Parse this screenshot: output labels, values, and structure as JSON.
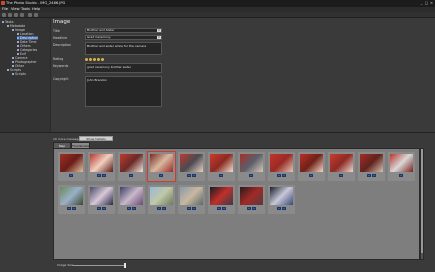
{
  "window": {
    "title": "The Photo Studio - IMG_2486.JPG",
    "controls": [
      "_",
      "□",
      "×"
    ]
  },
  "menu": [
    "File",
    "View",
    "Tools",
    "Help"
  ],
  "tree": {
    "items": [
      {
        "label": "Tasks",
        "level": 0
      },
      {
        "label": "Metadata",
        "level": 1
      },
      {
        "label": "Image",
        "level": 2
      },
      {
        "label": "Location",
        "level": 3
      },
      {
        "label": "Description",
        "level": 3,
        "selected": true
      },
      {
        "label": "Date Time",
        "level": 3
      },
      {
        "label": "Others",
        "level": 3
      },
      {
        "label": "Categories",
        "level": 3
      },
      {
        "label": "Exif",
        "level": 3
      },
      {
        "label": "Camera",
        "level": 2
      },
      {
        "label": "Photographer",
        "level": 2
      },
      {
        "label": "Other",
        "level": 2
      },
      {
        "label": "Scripts",
        "level": 1
      },
      {
        "label": "Scripts",
        "level": 2
      }
    ]
  },
  "detail": {
    "heading": "Image",
    "title_label": "Title",
    "title_value": "Brother and Sister",
    "headline_label": "Headline",
    "headline_value": "Grad Ceremony",
    "description_label": "Description",
    "description_value": "Brother and sister smile for the camera",
    "rating_label": "Rating",
    "rating_value": 5,
    "keywords_label": "Keywords",
    "keywords_value": "grad ceremony brother sister",
    "copyright_label": "Copyright",
    "copyright_value": "John Brandon"
  },
  "filter": {
    "label": "10 more messages",
    "button": "Show Details"
  },
  "tabs": [
    "Map Browse",
    "Thumbnails"
  ],
  "active_tab": 1,
  "zoom_label": "Image Size",
  "zoom_level": 1.0,
  "thumbnails": {
    "row1": [
      {
        "colors": [
          "#a0302a",
          "#6a1c18",
          "#e0c0a0"
        ],
        "selected": false
      },
      {
        "colors": [
          "#b8352e",
          "#f0d0c0",
          "#5a1a16"
        ],
        "selected": false
      },
      {
        "colors": [
          "#c23a30",
          "#6a2a28",
          "#f2e6dc"
        ],
        "selected": false
      },
      {
        "colors": [
          "#7a2a24",
          "#d8b8a0",
          "#9a2c26"
        ],
        "selected": true
      },
      {
        "colors": [
          "#c03a2e",
          "#4a4a52",
          "#e8d0c0"
        ],
        "selected": false
      },
      {
        "colors": [
          "#d03a2e",
          "#8a2a22",
          "#f0e0d0"
        ],
        "selected": false
      },
      {
        "colors": [
          "#a8302a",
          "#5a5e6a",
          "#d8c8b8"
        ],
        "selected": false
      },
      {
        "colors": [
          "#c0362c",
          "#9a2a24",
          "#e0c8b8"
        ],
        "selected": false
      },
      {
        "colors": [
          "#b83026",
          "#702018",
          "#f0d8c8"
        ],
        "selected": false
      },
      {
        "colors": [
          "#c83c30",
          "#8e2a24",
          "#eadad0"
        ],
        "selected": false
      },
      {
        "colors": [
          "#a42e28",
          "#60221c",
          "#d8c0b0"
        ],
        "selected": false
      },
      {
        "colors": [
          "#b8342a",
          "#d8d8d8",
          "#78221c"
        ],
        "selected": false
      }
    ],
    "row2": [
      {
        "colors": [
          "#6a8a5a",
          "#9ab0c8",
          "#3a4a30"
        ],
        "selected": false
      },
      {
        "colors": [
          "#4a4a6a",
          "#d8c8d8",
          "#2a2a44"
        ],
        "selected": false
      },
      {
        "colors": [
          "#3a4068",
          "#c8b8c8",
          "#6a4a7a"
        ],
        "selected": false
      },
      {
        "colors": [
          "#9ab8d8",
          "#c0c8a8",
          "#6a7a5a"
        ],
        "selected": false
      },
      {
        "colors": [
          "#8a9aaa",
          "#c8b8a0",
          "#5a6a6a"
        ],
        "selected": false
      },
      {
        "colors": [
          "#1a1a22",
          "#c0302a",
          "#3a3a48"
        ],
        "selected": false
      },
      {
        "colors": [
          "#2a1a1c",
          "#a02a26",
          "#5a3a40"
        ],
        "selected": false
      },
      {
        "colors": [
          "#1a1e2a",
          "#c8c8d8",
          "#3a4a7a"
        ],
        "selected": false
      }
    ]
  },
  "icon_names": [
    "app-icon",
    "tree-bullet-icon",
    "dropdown-arrow-icon",
    "star-icon",
    "info-icon",
    "slider-knob-icon"
  ]
}
